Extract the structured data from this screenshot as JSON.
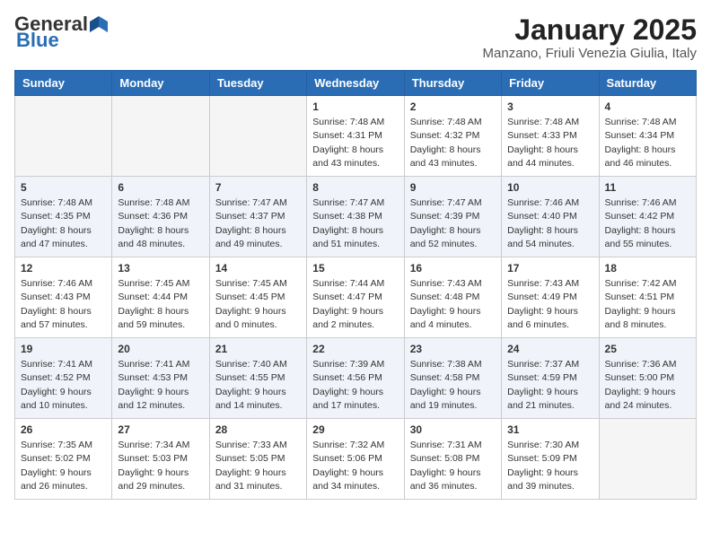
{
  "header": {
    "logo_general": "General",
    "logo_blue": "Blue",
    "month_title": "January 2025",
    "location": "Manzano, Friuli Venezia Giulia, Italy"
  },
  "weekdays": [
    "Sunday",
    "Monday",
    "Tuesday",
    "Wednesday",
    "Thursday",
    "Friday",
    "Saturday"
  ],
  "weeks": [
    [
      {
        "day": "",
        "info": ""
      },
      {
        "day": "",
        "info": ""
      },
      {
        "day": "",
        "info": ""
      },
      {
        "day": "1",
        "info": "Sunrise: 7:48 AM\nSunset: 4:31 PM\nDaylight: 8 hours and 43 minutes."
      },
      {
        "day": "2",
        "info": "Sunrise: 7:48 AM\nSunset: 4:32 PM\nDaylight: 8 hours and 43 minutes."
      },
      {
        "day": "3",
        "info": "Sunrise: 7:48 AM\nSunset: 4:33 PM\nDaylight: 8 hours and 44 minutes."
      },
      {
        "day": "4",
        "info": "Sunrise: 7:48 AM\nSunset: 4:34 PM\nDaylight: 8 hours and 46 minutes."
      }
    ],
    [
      {
        "day": "5",
        "info": "Sunrise: 7:48 AM\nSunset: 4:35 PM\nDaylight: 8 hours and 47 minutes."
      },
      {
        "day": "6",
        "info": "Sunrise: 7:48 AM\nSunset: 4:36 PM\nDaylight: 8 hours and 48 minutes."
      },
      {
        "day": "7",
        "info": "Sunrise: 7:47 AM\nSunset: 4:37 PM\nDaylight: 8 hours and 49 minutes."
      },
      {
        "day": "8",
        "info": "Sunrise: 7:47 AM\nSunset: 4:38 PM\nDaylight: 8 hours and 51 minutes."
      },
      {
        "day": "9",
        "info": "Sunrise: 7:47 AM\nSunset: 4:39 PM\nDaylight: 8 hours and 52 minutes."
      },
      {
        "day": "10",
        "info": "Sunrise: 7:46 AM\nSunset: 4:40 PM\nDaylight: 8 hours and 54 minutes."
      },
      {
        "day": "11",
        "info": "Sunrise: 7:46 AM\nSunset: 4:42 PM\nDaylight: 8 hours and 55 minutes."
      }
    ],
    [
      {
        "day": "12",
        "info": "Sunrise: 7:46 AM\nSunset: 4:43 PM\nDaylight: 8 hours and 57 minutes."
      },
      {
        "day": "13",
        "info": "Sunrise: 7:45 AM\nSunset: 4:44 PM\nDaylight: 8 hours and 59 minutes."
      },
      {
        "day": "14",
        "info": "Sunrise: 7:45 AM\nSunset: 4:45 PM\nDaylight: 9 hours and 0 minutes."
      },
      {
        "day": "15",
        "info": "Sunrise: 7:44 AM\nSunset: 4:47 PM\nDaylight: 9 hours and 2 minutes."
      },
      {
        "day": "16",
        "info": "Sunrise: 7:43 AM\nSunset: 4:48 PM\nDaylight: 9 hours and 4 minutes."
      },
      {
        "day": "17",
        "info": "Sunrise: 7:43 AM\nSunset: 4:49 PM\nDaylight: 9 hours and 6 minutes."
      },
      {
        "day": "18",
        "info": "Sunrise: 7:42 AM\nSunset: 4:51 PM\nDaylight: 9 hours and 8 minutes."
      }
    ],
    [
      {
        "day": "19",
        "info": "Sunrise: 7:41 AM\nSunset: 4:52 PM\nDaylight: 9 hours and 10 minutes."
      },
      {
        "day": "20",
        "info": "Sunrise: 7:41 AM\nSunset: 4:53 PM\nDaylight: 9 hours and 12 minutes."
      },
      {
        "day": "21",
        "info": "Sunrise: 7:40 AM\nSunset: 4:55 PM\nDaylight: 9 hours and 14 minutes."
      },
      {
        "day": "22",
        "info": "Sunrise: 7:39 AM\nSunset: 4:56 PM\nDaylight: 9 hours and 17 minutes."
      },
      {
        "day": "23",
        "info": "Sunrise: 7:38 AM\nSunset: 4:58 PM\nDaylight: 9 hours and 19 minutes."
      },
      {
        "day": "24",
        "info": "Sunrise: 7:37 AM\nSunset: 4:59 PM\nDaylight: 9 hours and 21 minutes."
      },
      {
        "day": "25",
        "info": "Sunrise: 7:36 AM\nSunset: 5:00 PM\nDaylight: 9 hours and 24 minutes."
      }
    ],
    [
      {
        "day": "26",
        "info": "Sunrise: 7:35 AM\nSunset: 5:02 PM\nDaylight: 9 hours and 26 minutes."
      },
      {
        "day": "27",
        "info": "Sunrise: 7:34 AM\nSunset: 5:03 PM\nDaylight: 9 hours and 29 minutes."
      },
      {
        "day": "28",
        "info": "Sunrise: 7:33 AM\nSunset: 5:05 PM\nDaylight: 9 hours and 31 minutes."
      },
      {
        "day": "29",
        "info": "Sunrise: 7:32 AM\nSunset: 5:06 PM\nDaylight: 9 hours and 34 minutes."
      },
      {
        "day": "30",
        "info": "Sunrise: 7:31 AM\nSunset: 5:08 PM\nDaylight: 9 hours and 36 minutes."
      },
      {
        "day": "31",
        "info": "Sunrise: 7:30 AM\nSunset: 5:09 PM\nDaylight: 9 hours and 39 minutes."
      },
      {
        "day": "",
        "info": ""
      }
    ]
  ]
}
